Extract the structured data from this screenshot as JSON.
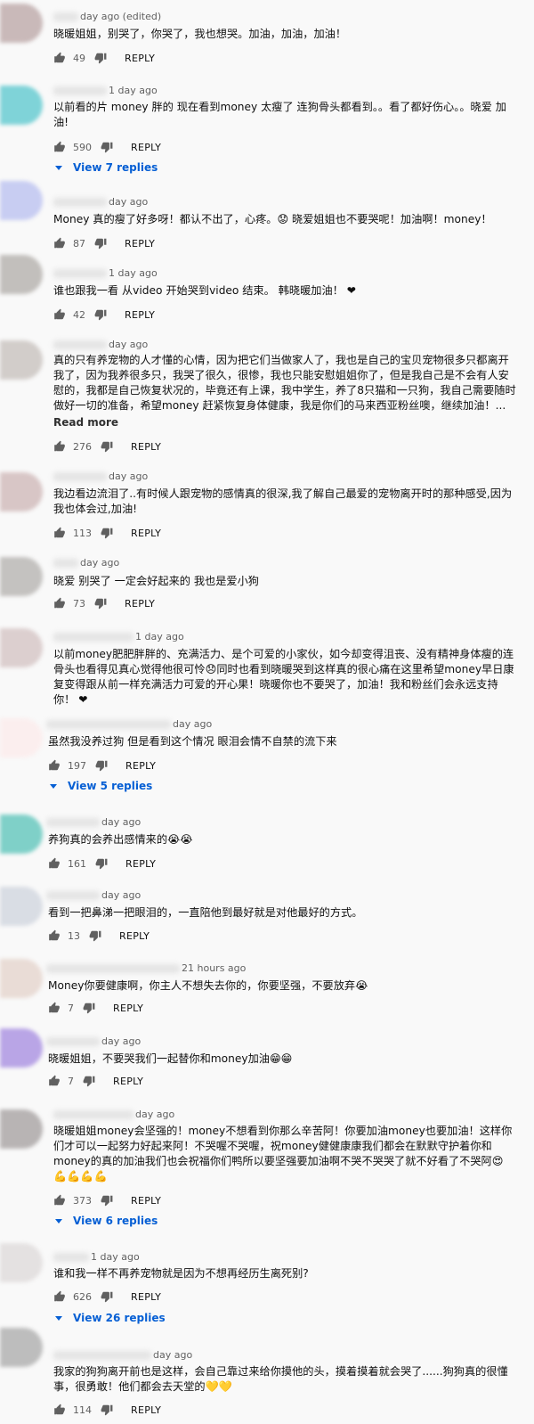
{
  "labels": {
    "reply": "REPLY",
    "read_more": "Read more"
  },
  "comments": [
    {
      "time": "day ago (edited)",
      "text": "晓暖姐姐，别哭了，你哭了，我也想哭。加油，加油，加油！",
      "likes": "49"
    },
    {
      "time": "1 day ago",
      "text": "以前看的片 money 胖的 现在看到money 太瘦了 连狗骨头都看到。。看了都好伤心。。晓爱 加油!",
      "likes": "590",
      "replies": "View 7 replies"
    },
    {
      "time": "day ago",
      "text": "Money 真的瘦了好多呀！都认不出了，心疼。😟 晓爱姐姐也不要哭呢！加油啊！money！",
      "likes": "87"
    },
    {
      "time": "1 day ago",
      "text": "谁也跟我一看 从video 开始哭到video 结束。 韩晓暖加油！ ❤",
      "likes": "42"
    },
    {
      "time": "day ago",
      "text": "真的只有养宠物的人才懂的心情，因为把它们当做家人了，我也是自己的宝贝宠物很多只都离开我了，因为我养很多只，我哭了很久，很惨，我也只能安慰姐姐你了，但是我自己是不会有人安慰的，我都是自己恢复状况的，毕竟还有上课，我中学生，养了8只猫和一只狗，我自己需要随时做好一切的准备，希望money 赶紧恢复身体健康，我是你们的马来西亚粉丝噢，继续加油！...",
      "likes": "276"
    },
    {
      "time": "day ago",
      "text": "我边看边流泪了..有时候人跟宠物的感情真的很深,我了解自己最爱的宠物离开时的那种感受,因为我也体会过,加油!",
      "likes": "113"
    },
    {
      "time": "day ago",
      "text": "晓爱 别哭了 一定会好起来的 我也是爱小狗",
      "likes": "73"
    },
    {
      "time": "1 day ago",
      "text": "以前money肥肥胖胖的、充满活力、是个可爱的小家伙，如今却变得沮丧、没有精神身体瘦的连骨头也看得见真心觉得他很可怜😞同时也看到晓暖哭到这样真的很心痛在这里希望money早日康复变得跟从前一样充满活力可爱的开心果！晓暖你也不要哭了，加油！我和粉丝们会永远支持你！ ❤"
    },
    {
      "time": "day ago",
      "text": "虽然我没养过狗 但是看到这个情况 眼泪会情不自禁的流下来",
      "likes": "197",
      "replies": "View 5 replies"
    },
    {
      "time": "day ago",
      "text": "养狗真的会养出感情来的😭😭",
      "likes": "161"
    },
    {
      "time": "day ago",
      "text": "看到一把鼻涕一把眼泪的，一直陪他到最好就是对他最好的方式。",
      "likes": "13"
    },
    {
      "time": "21 hours ago",
      "text": "Money你要健康啊，你主人不想失去你的，你要坚强，不要放弃😭",
      "likes": "7"
    },
    {
      "time": "day ago",
      "text": "晓暖姐姐，不要哭我们一起替你和money加油😁😁",
      "likes": "7"
    },
    {
      "time": "day ago",
      "text": "晓暖姐姐money会坚强的！money不想看到你那么辛苦阿！你要加油money也要加油！这样你们才可以一起努力好起来阿！不哭喔不哭喔，祝money健健康康我们都会在默默守护着你和money的真的加油我们也会祝福你们鸭所以要坚强要加油啊不哭不哭哭了就不好看了不哭阿😍💪💪💪💪",
      "likes": "373",
      "replies": "View 6 replies"
    },
    {
      "time": "1 day ago",
      "text": "谁和我一样不再养宠物就是因为不想再经历生离死别?",
      "likes": "626",
      "replies": "View 26 replies"
    },
    {
      "time": "day ago",
      "text": "我家的狗狗离开前也是这样，会自己靠过来给你摸他的头，摸着摸着就会哭了......狗狗真的很懂事，很勇敢！他们都会去天堂的💛💛",
      "likes": "114"
    }
  ],
  "colors": {
    "link": "#065fd4",
    "heart": "#e52222"
  }
}
